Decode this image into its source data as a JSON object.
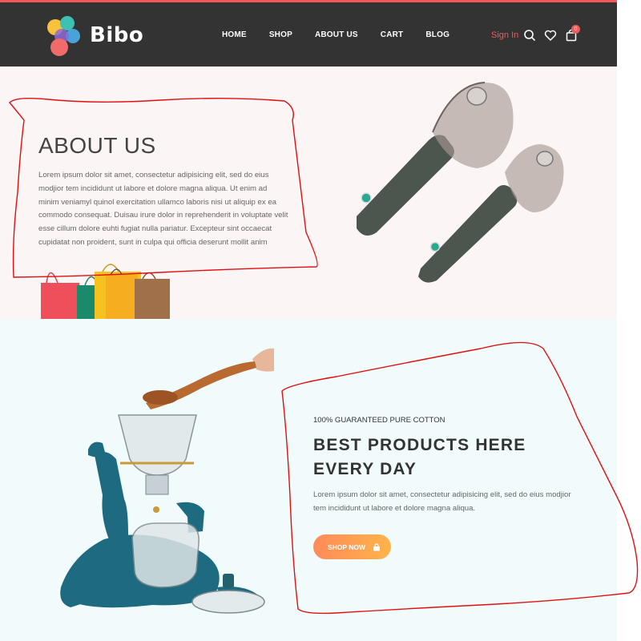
{
  "header": {
    "brand": "Bibo",
    "nav": [
      "HOME",
      "SHOP",
      "ABOUT US",
      "CART",
      "BLOG"
    ],
    "sign_in": "Sign In",
    "cart_count": "0",
    "icons": [
      "search-icon",
      "heart-icon",
      "cart-icon"
    ]
  },
  "about": {
    "title": "ABOUT US",
    "body": "Lorem ipsum dolor sit amet, consectetur adipisicing elit, sed do eius modjior tem incididunt ut labore et dolore magna aliqua. Ut enim ad minim veniamyl quinol exercitation ullamco laboris nisi ut aliquip ex ea commodo consequat. Duisau irure dolor in reprehenderit in voluptate velit esse cillum dolore euhti fugiat nulla pariatur. Excepteur sint occaecat cupidatat non proident, sunt in culpa qui officia deserunt mollit anim"
  },
  "products": {
    "eyebrow": "100% GUARANTEED PURE COTTON",
    "headline_line1": "BEST PRODUCTS HERE",
    "headline_line2": "EVERY DAY",
    "body": "Lorem ipsum dolor sit amet, consectetur adipisicing elit, sed do eius modjior tem incididunt ut labore et dolore magna aliqua.",
    "cta": "SHOP NOW"
  },
  "colors": {
    "accent": "#f05a5a",
    "header_bg": "#333333",
    "about_bg": "#fbf5f5",
    "products_bg": "#f1fbfb",
    "button_from": "#ff8a5a",
    "button_to": "#ffb44a",
    "annotation": "#e01010"
  }
}
